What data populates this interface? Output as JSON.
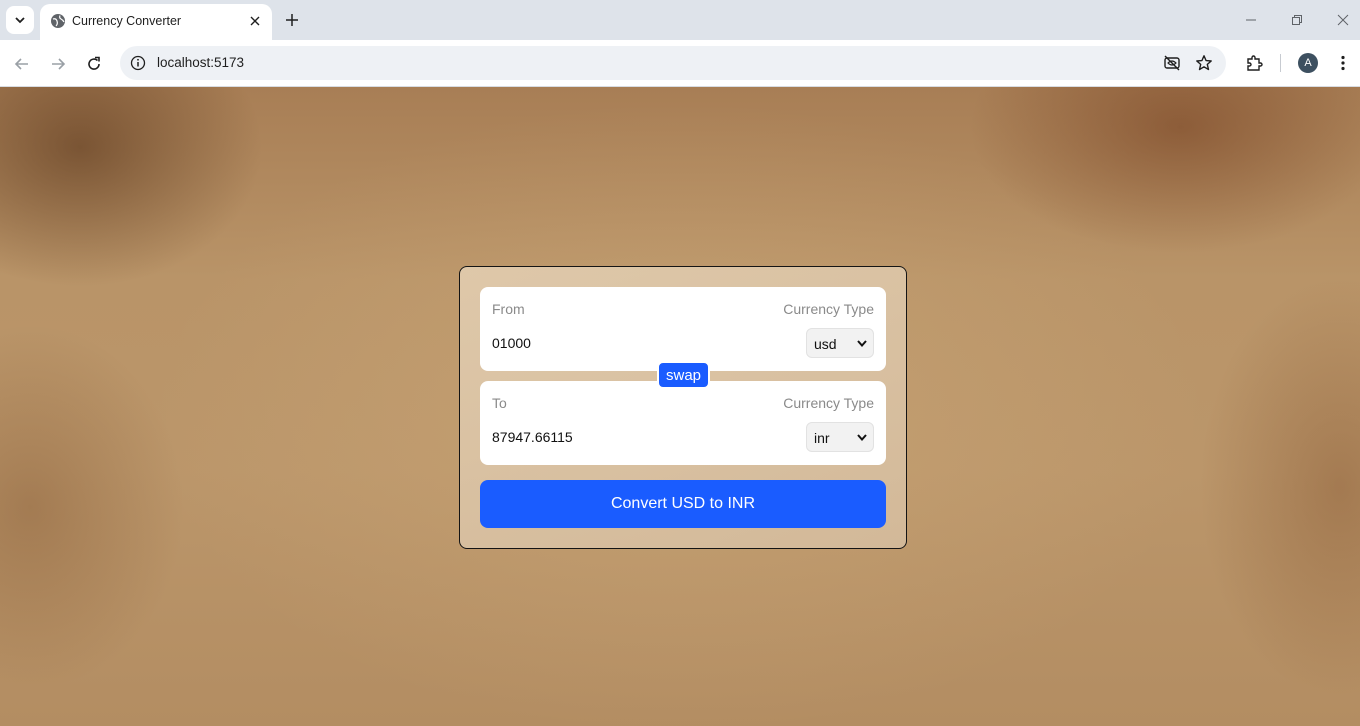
{
  "browser": {
    "tab_title": "Currency Converter",
    "url": "localhost:5173",
    "avatar_letter": "A",
    "icons": {
      "tab_search": "chevron-down-icon",
      "favicon": "globe-icon",
      "tab_close": "close-icon",
      "new_tab": "plus-icon",
      "back": "arrow-left-icon",
      "forward": "arrow-right-icon",
      "reload": "reload-icon",
      "site_info": "info-icon",
      "eye_off": "eye-off-icon",
      "bookmark": "star-icon",
      "extensions": "puzzle-icon",
      "menu": "kebab-menu-icon"
    }
  },
  "converter": {
    "from": {
      "label": "From",
      "currency_type_label": "Currency Type",
      "amount": "01000",
      "currency": "usd"
    },
    "swap_label": "swap",
    "to": {
      "label": "To",
      "currency_type_label": "Currency Type",
      "amount": "87947.66115",
      "currency": "inr"
    },
    "convert_label": "Convert USD to INR"
  },
  "colors": {
    "accent": "#1a5cff",
    "card_border": "#141414"
  }
}
